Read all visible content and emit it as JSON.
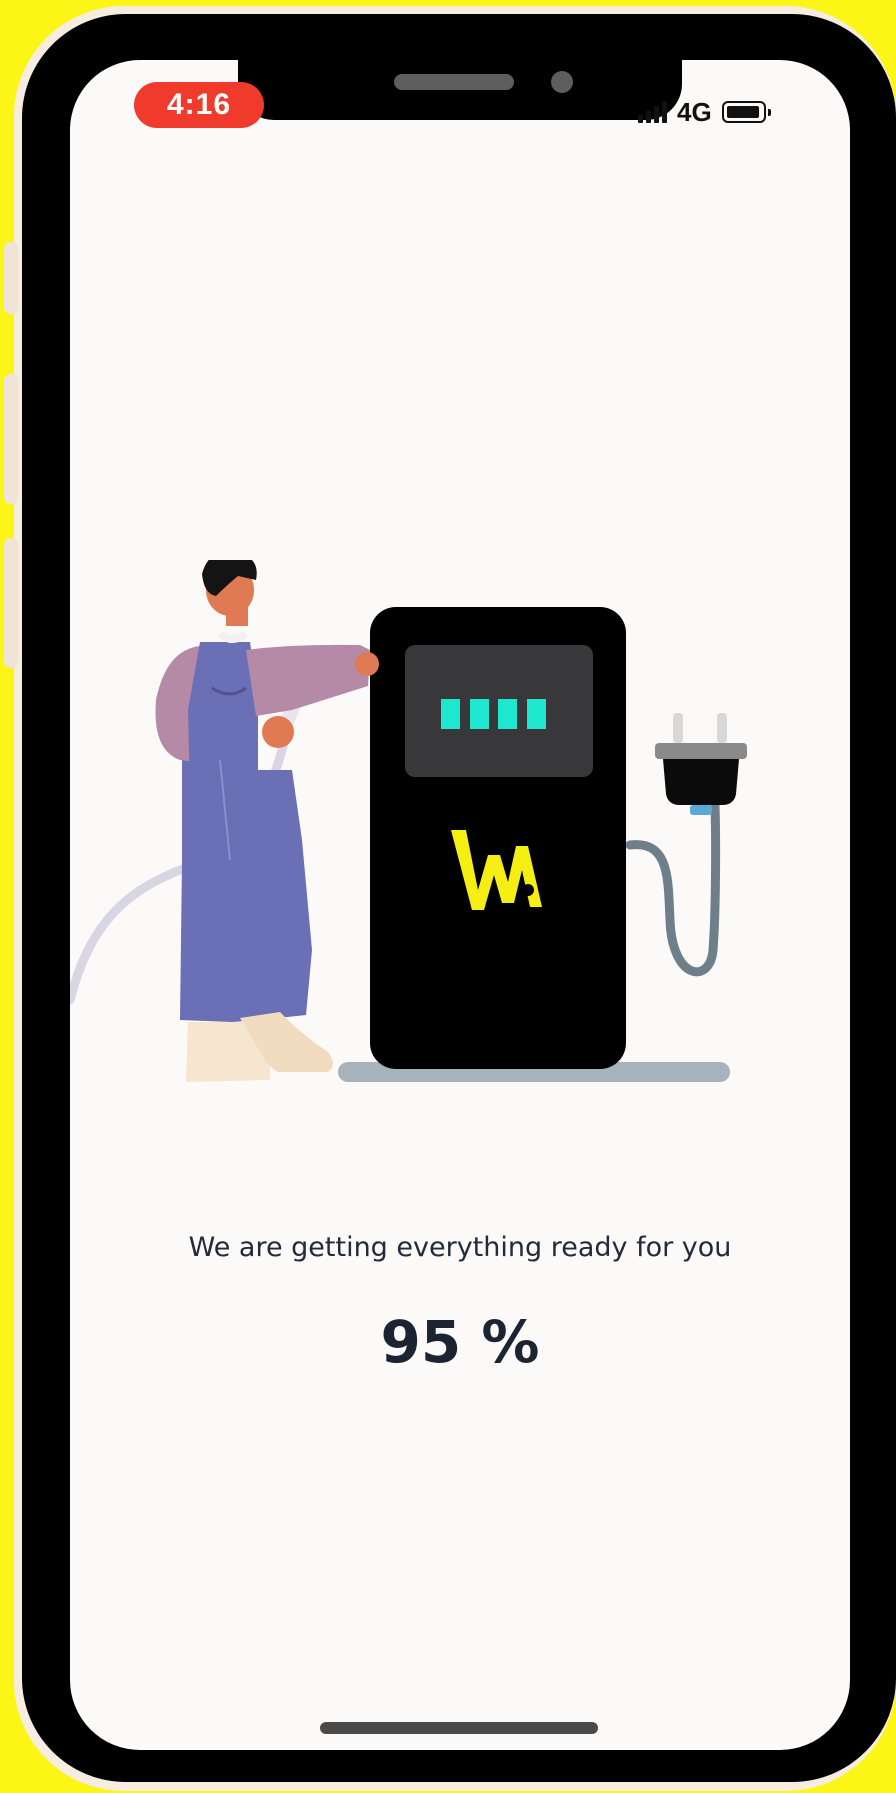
{
  "status_bar": {
    "time": "4:16",
    "network": "4G",
    "signal_bars": 4,
    "battery_level": 0.85
  },
  "illustration": {
    "logo_text": "W.A",
    "charger_display_segments": 4,
    "colors": {
      "display_segment": "#1de7cf",
      "logo": "#f5ee12",
      "overalls": "#6a6fb6",
      "shirt": "#b58aa6",
      "charger": "#000000"
    }
  },
  "loading": {
    "message": "We are getting everything ready for you",
    "progress_label": "95 %",
    "progress_value": 95
  },
  "colors": {
    "background_outer": "#fbf616",
    "screen_background": "#fbfaf8",
    "time_pill": "#ef3a2c",
    "text_primary": "#1c2432"
  }
}
